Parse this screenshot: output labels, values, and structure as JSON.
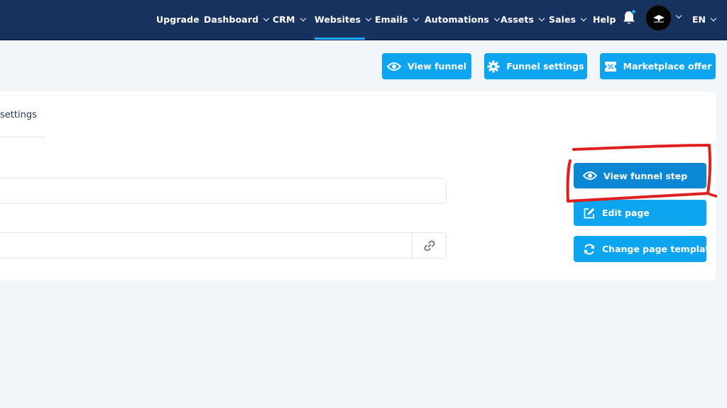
{
  "nav": {
    "items": [
      {
        "label": "Upgrade",
        "dropdown": false
      },
      {
        "label": "Dashboard",
        "dropdown": true
      },
      {
        "label": "CRM",
        "dropdown": true
      },
      {
        "label": "Websites",
        "dropdown": true,
        "active": true
      },
      {
        "label": "Emails",
        "dropdown": true
      },
      {
        "label": "Automations",
        "dropdown": true
      },
      {
        "label": "Assets",
        "dropdown": true
      },
      {
        "label": "Sales",
        "dropdown": true
      },
      {
        "label": "Help",
        "dropdown": false
      }
    ],
    "notification_icon": "bell-icon",
    "language": "EN"
  },
  "toolbar": {
    "view_funnel": "View funnel",
    "funnel_settings": "Funnel settings",
    "marketplace_offer": "Marketplace offer"
  },
  "card": {
    "tab_label": "settings",
    "actions": {
      "view_step": "View funnel step",
      "edit_page": "Edit page",
      "change_template": "Change page template"
    }
  },
  "colors": {
    "nav_bg": "#17325f",
    "accent": "#0ea5f0",
    "annotation": "#e02020"
  }
}
